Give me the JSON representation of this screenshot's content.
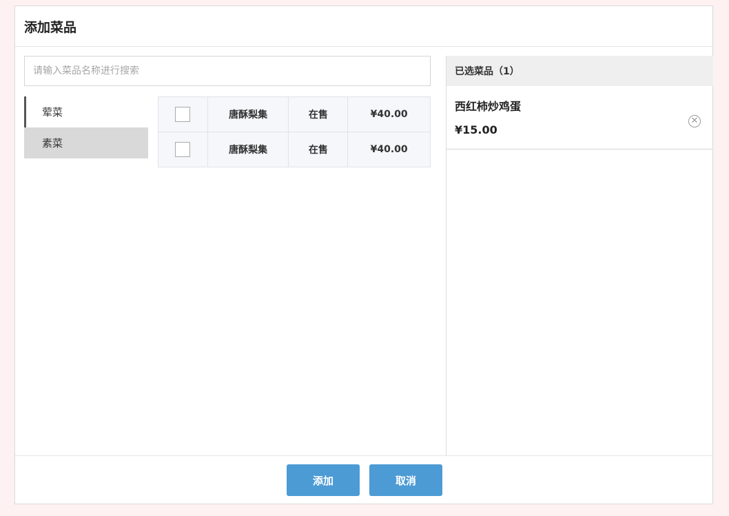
{
  "dialog": {
    "title": "添加菜品"
  },
  "search": {
    "placeholder": "请输入菜品名称进行搜索",
    "value": ""
  },
  "categories": [
    {
      "label": "荤菜"
    },
    {
      "label": "素菜"
    }
  ],
  "dishes": [
    {
      "name": "唐酥梨集",
      "status": "在售",
      "price": "¥40.00"
    },
    {
      "name": "唐酥梨集",
      "status": "在售",
      "price": "¥40.00"
    }
  ],
  "selected_panel": {
    "header": "已选菜品（1）",
    "items": [
      {
        "name": "西红柿炒鸡蛋",
        "price": "¥15.00"
      }
    ]
  },
  "footer": {
    "add_label": "添加",
    "cancel_label": "取消"
  },
  "colors": {
    "accent": "#4c9bd5",
    "page_bg": "#fdf1f2"
  },
  "icons": {
    "remove": "close-circle-icon"
  }
}
